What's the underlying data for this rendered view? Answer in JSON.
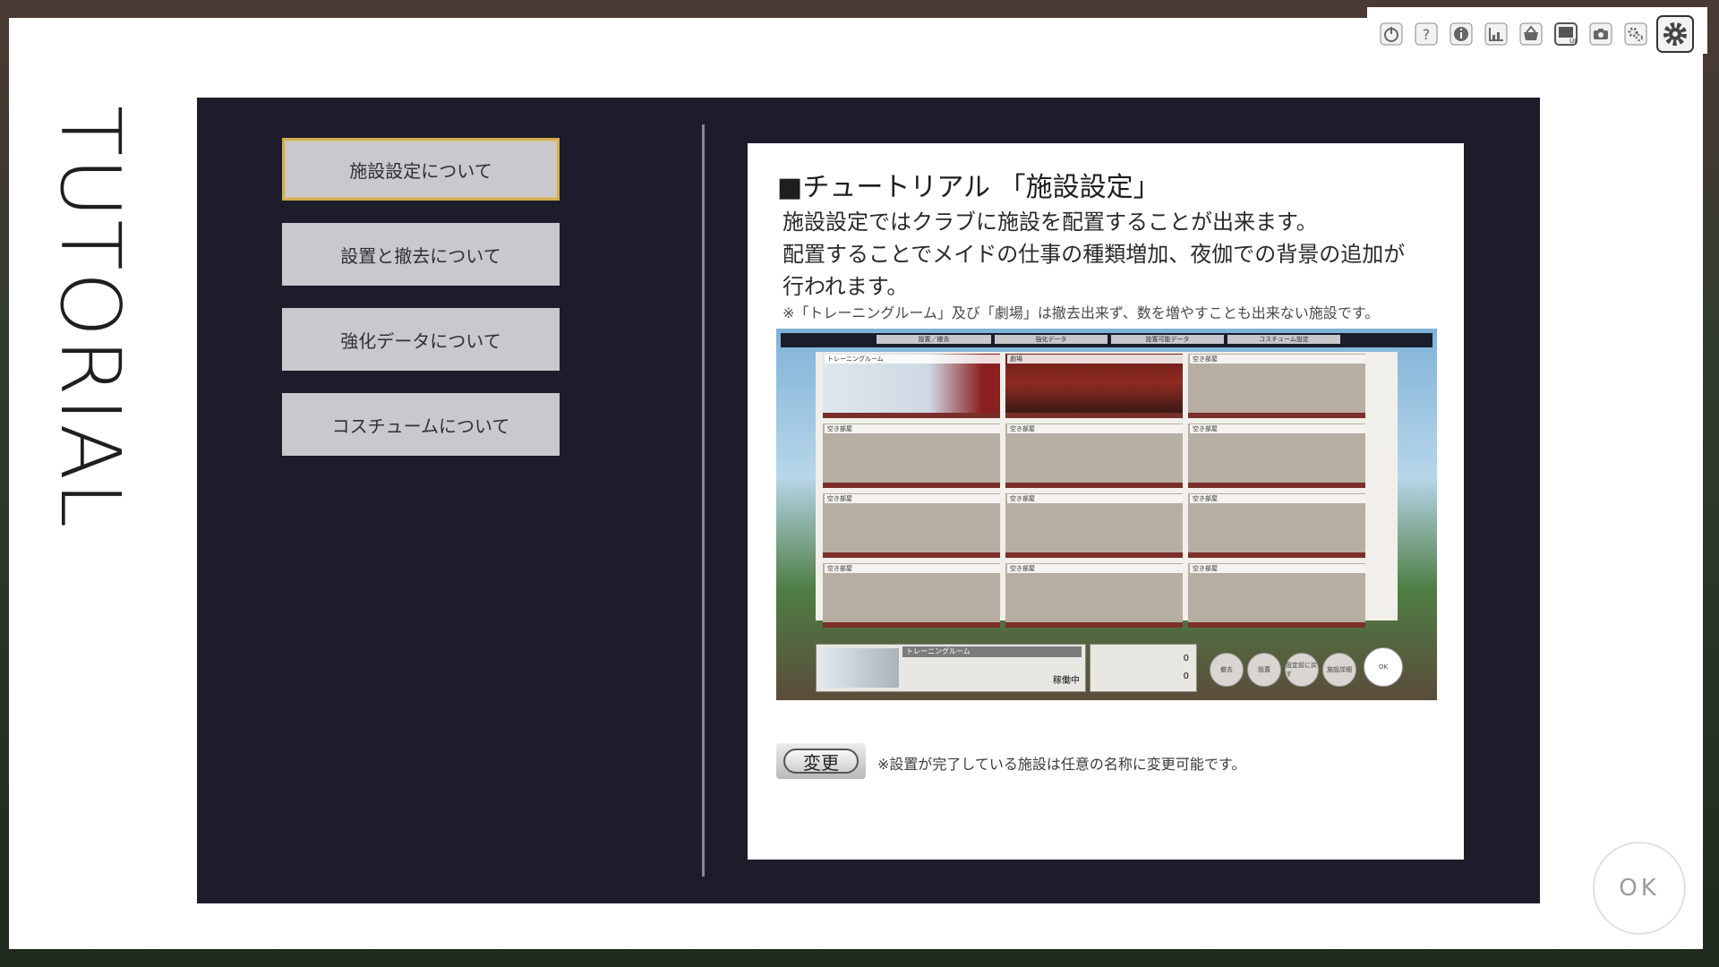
{
  "colors": {
    "dark_panel": "#1d1c2b",
    "button_bg": "#c9c8cd",
    "active_border": "#d3ae4e"
  },
  "title": "TUTORIAL",
  "topics": [
    {
      "label": "施設設定について"
    },
    {
      "label": "設置と撤去について"
    },
    {
      "label": "強化データについて"
    },
    {
      "label": "コスチュームについて"
    }
  ],
  "content": {
    "title": "■チュートリアル 「施設設定」",
    "body_lines": [
      "施設設定ではクラブに施設を配置することが出来ます。",
      "配置することでメイドの仕事の種類増加、夜伽での背景の追加が",
      "行われます。"
    ],
    "note": "※「トレーニングルーム」及び「劇場」は撤去出来ず、数を増やすことも出来ない施設です。",
    "change_button": "変更",
    "change_note": "※設置が完了している施設は任意の名称に変更可能です。",
    "screenshot": {
      "tabs": [
        "設置／撤去",
        "強化データ",
        "設置可能データ",
        "コスチューム設定"
      ],
      "rooms": [
        "トレーニングルーム",
        "劇場",
        "空き部屋",
        "空き部屋",
        "空き部屋",
        "空き部屋",
        "空き部屋",
        "空き部屋",
        "空き部屋",
        "空き部屋",
        "空き部屋",
        "空き部屋"
      ],
      "info_title": "トレーニングルーム",
      "status": "稼働中",
      "cost_lines": [
        "0",
        "0"
      ],
      "buttons": [
        "撤去",
        "設置",
        "設定前に戻す",
        "施設詳細",
        "OK"
      ]
    }
  },
  "toolbar_icons": [
    "power-icon",
    "help-icon",
    "info-icon",
    "chart-icon",
    "basket-icon",
    "ui-toggle-icon",
    "camera-icon",
    "settings-small-icon",
    "gear-icon"
  ],
  "ok_label": "OK"
}
